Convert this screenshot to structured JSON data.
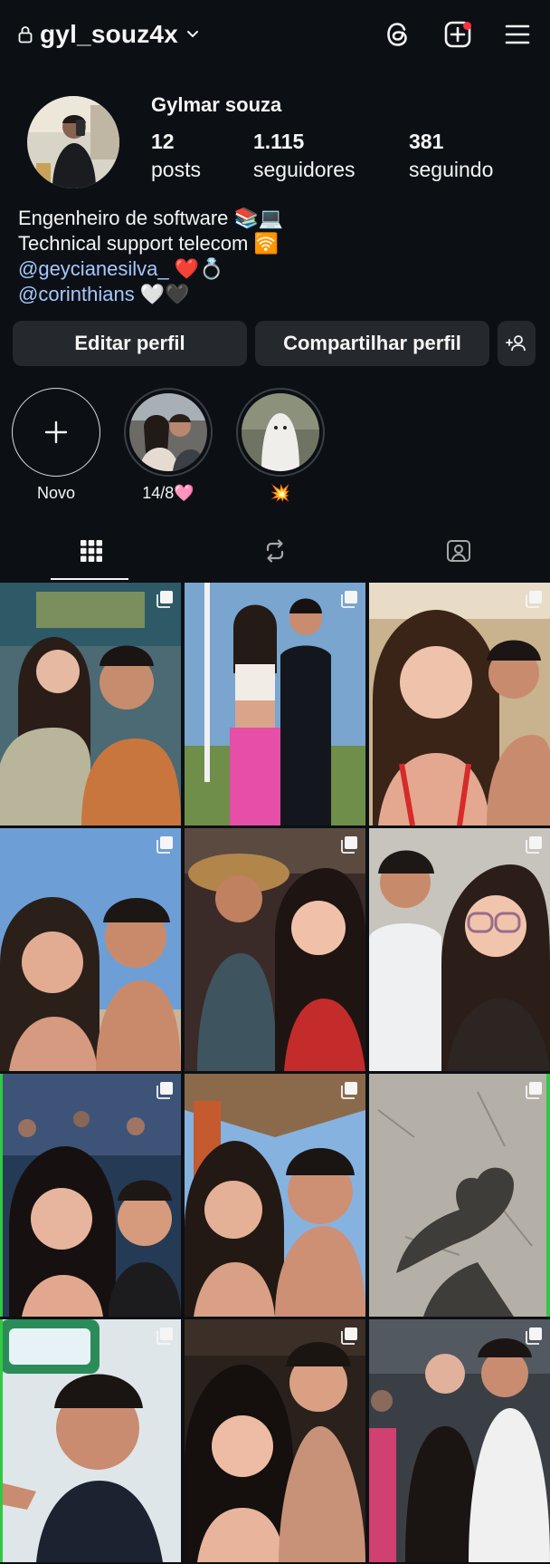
{
  "header": {
    "username": "gyl_souz4x",
    "icons": [
      "lock-icon",
      "chevron-down-icon",
      "threads-icon",
      "create-post-icon",
      "menu-icon"
    ]
  },
  "profile": {
    "display_name": "Gylmar souza",
    "stats": {
      "posts_count": "12",
      "posts_label": "posts",
      "followers_count": "1.115",
      "followers_label": "seguidores",
      "following_count": "381",
      "following_label": "seguindo"
    },
    "bio": {
      "line1": "Engenheiro de software 📚💻",
      "line2": "Technical support telecom 🛜",
      "line3_mention": "@geycianesilva_",
      "line3_emoji": " ❤️💍",
      "line4_mention": "@corinthians",
      "line4_emoji": " 🤍🖤"
    }
  },
  "buttons": {
    "edit": "Editar perfil",
    "share": "Compartilhar perfil"
  },
  "highlights": [
    {
      "label": "Novo"
    },
    {
      "label": "14/8🩷"
    },
    {
      "label": "💥"
    }
  ],
  "tabs": [
    "grid-icon",
    "reels-icon",
    "tagged-icon"
  ],
  "colors": {
    "background": "#0c1014",
    "button": "#25292e",
    "mention": "#a5c7ff",
    "notification": "#ff3040",
    "edge_green": "#31c842"
  },
  "posts_grid": {
    "count": 12,
    "multi_photo_icon": "carousel-icon"
  }
}
